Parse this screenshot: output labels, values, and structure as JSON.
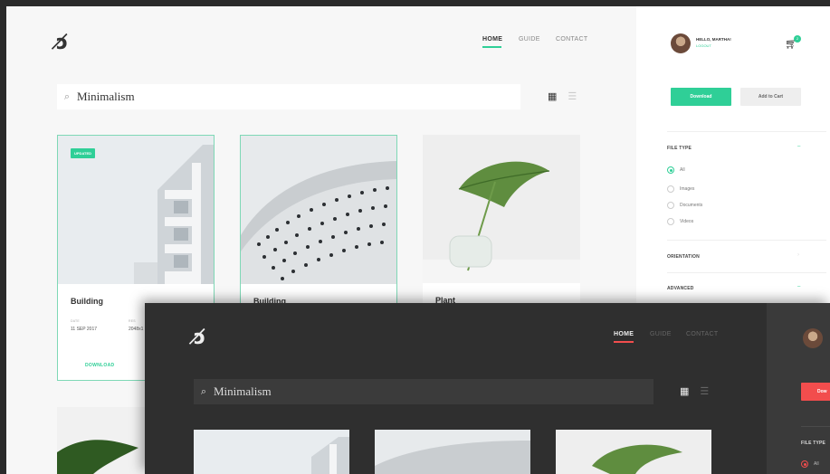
{
  "light": {
    "nav": {
      "home": "HOME",
      "guide": "GUIDE",
      "contact": "CONTACT"
    },
    "search": {
      "value": "Minimalism"
    },
    "cards": [
      {
        "badge": "UPDATED",
        "title": "Building",
        "date_label": "DATE",
        "date": "11 SEP 2017",
        "res_label": "RES",
        "res": "2048x1",
        "action": "DOWNLOAD"
      },
      {
        "title": "Building"
      },
      {
        "title": "Plant"
      }
    ],
    "user": {
      "greeting": "HELLO, MARTHA!",
      "logout": "LOGOUT"
    },
    "cart_count": "2",
    "download_button": "Download",
    "add_to_cart_button": "Add to Cart",
    "filters": {
      "file_type_title": "FILE TYPE",
      "options": [
        "All",
        "Images",
        "Documents",
        "Videos"
      ],
      "orientation_title": "ORIENTATION",
      "advanced_title": "ADVANCED"
    },
    "accent": "#2fcf97"
  },
  "dark": {
    "nav": {
      "home": "HOME",
      "guide": "GUIDE",
      "contact": "CONTACT"
    },
    "search": {
      "value": "Minimalism"
    },
    "download_button": "Dow",
    "filters": {
      "file_type_title": "FILE TYPE",
      "options": [
        "All"
      ]
    },
    "accent": "#f24d4d"
  }
}
